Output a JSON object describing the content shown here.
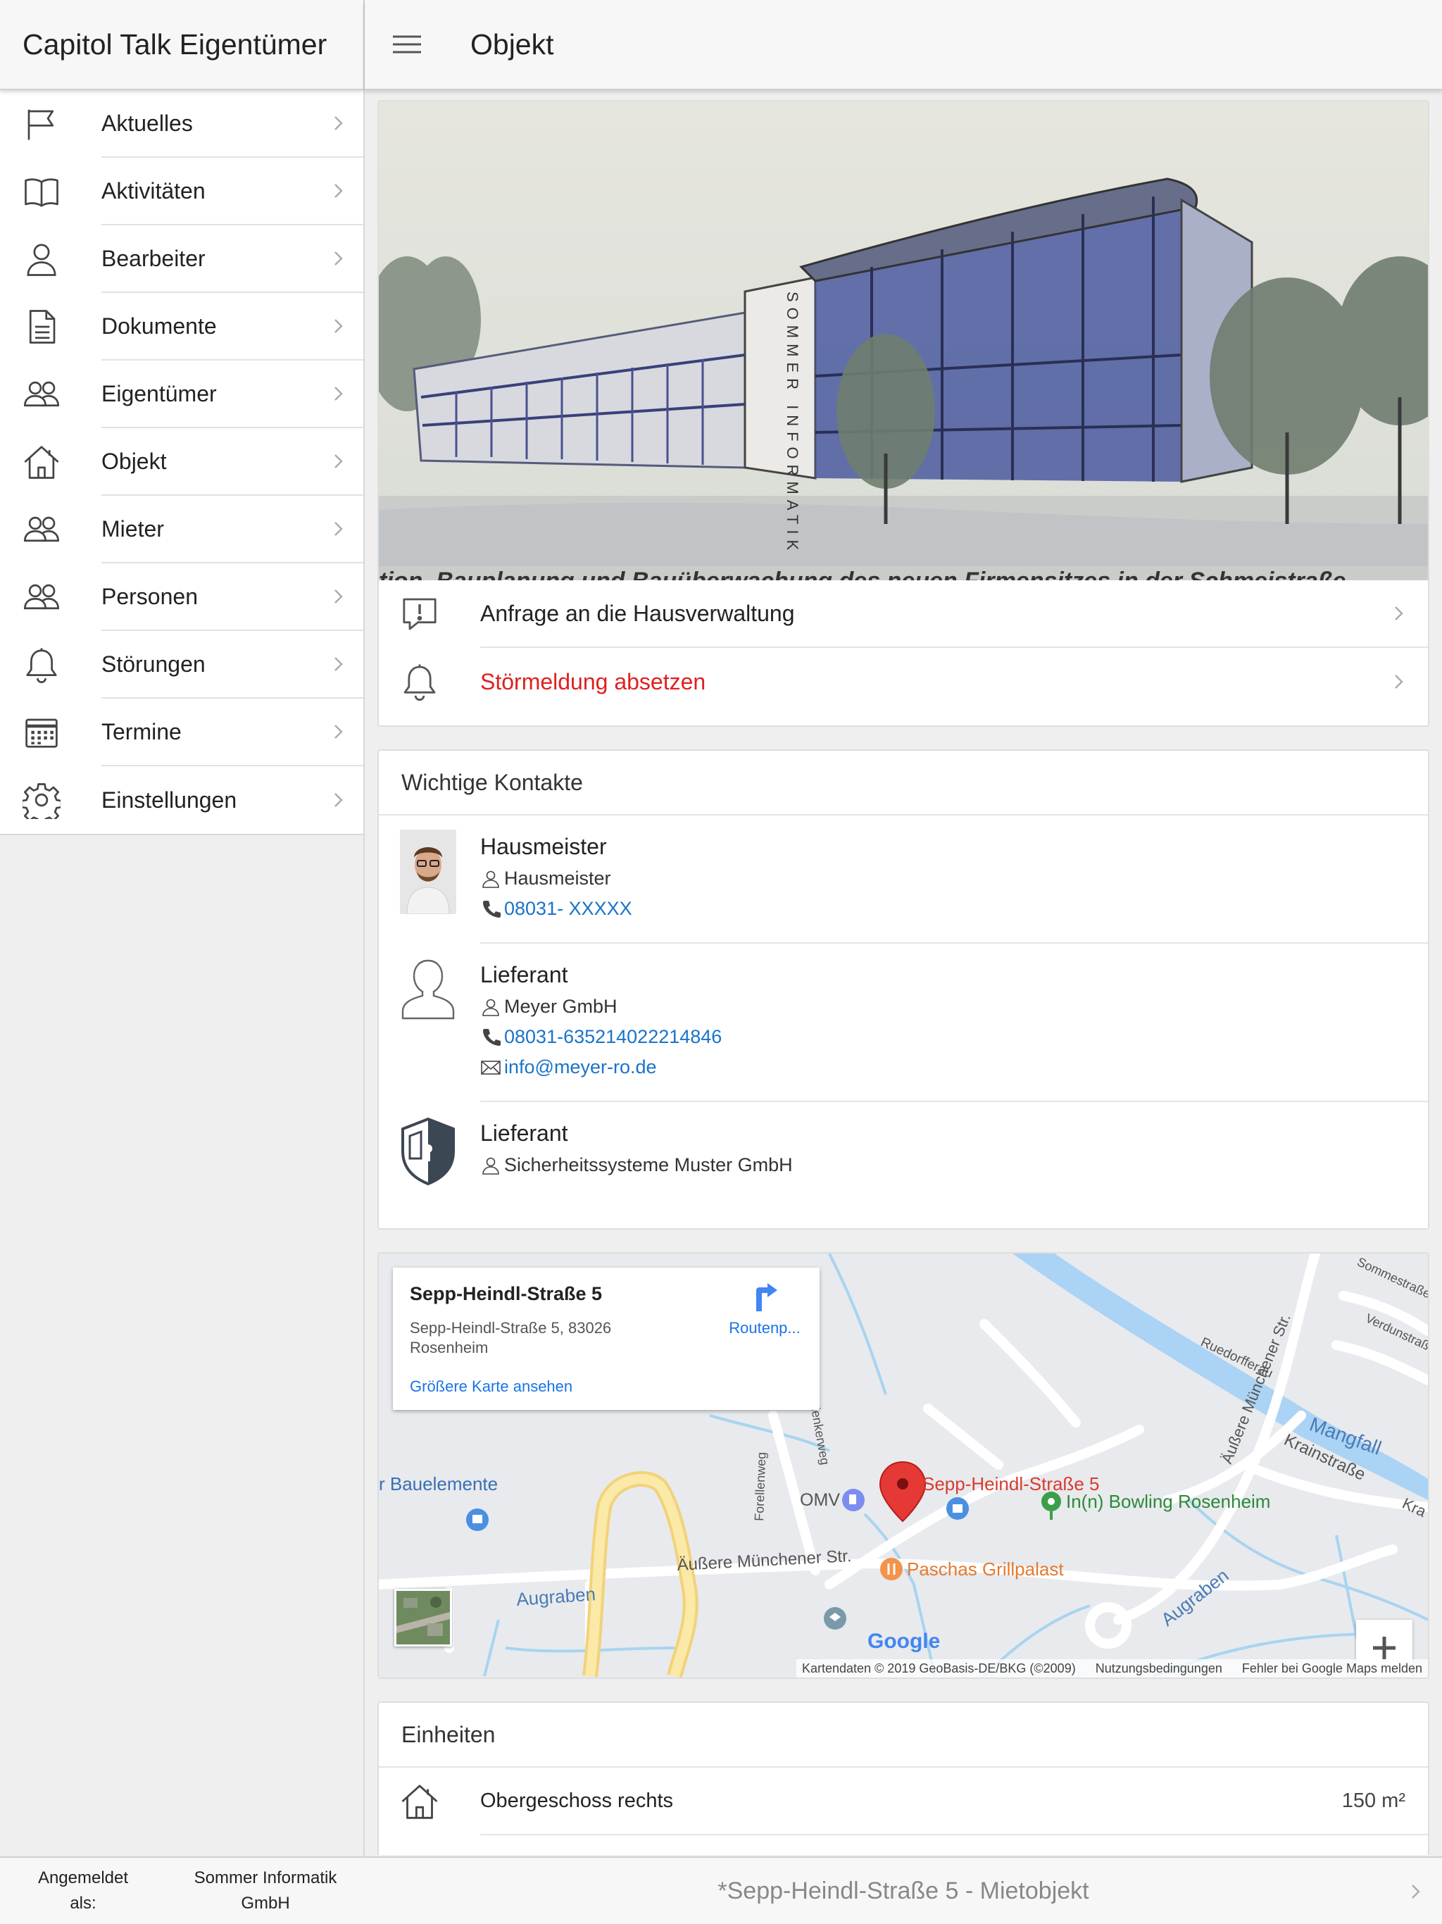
{
  "app": {
    "title": "Capitol Talk Eigentümer"
  },
  "topbar": {
    "title": "Objekt"
  },
  "menu": {
    "items": [
      {
        "label": "Aktuelles",
        "icon": "flag-icon"
      },
      {
        "label": "Aktivitäten",
        "icon": "book-icon"
      },
      {
        "label": "Bearbeiter",
        "icon": "person-icon"
      },
      {
        "label": "Dokumente",
        "icon": "document-icon"
      },
      {
        "label": "Eigentümer",
        "icon": "people-icon"
      },
      {
        "label": "Objekt",
        "icon": "home-icon"
      },
      {
        "label": "Mieter",
        "icon": "people-icon"
      },
      {
        "label": "Personen",
        "icon": "people-icon"
      },
      {
        "label": "Störungen",
        "icon": "bell-icon"
      },
      {
        "label": "Termine",
        "icon": "calendar-icon"
      },
      {
        "label": "Einstellungen",
        "icon": "gear-icon"
      }
    ]
  },
  "footer": {
    "login_label": "Angemeldet als:",
    "login_company": "Sommer Informatik GmbH",
    "object_selector": "*Sepp-Heindl-Straße 5 - Mietobjekt"
  },
  "object_card": {
    "caption": "tion, Bauplanung und Bauüberwachung des neuen Firmensitzes in der Schmeistraße",
    "building_sign": "SOMMER INFORMATIK",
    "actions": [
      {
        "label": "Anfrage an die Hausverwaltung",
        "icon": "message-alert-icon"
      },
      {
        "label": "Störmeldung absetzen",
        "icon": "bell-icon"
      }
    ]
  },
  "contacts": {
    "title": "Wichtige Kontakte",
    "items": [
      {
        "role": "Hausmeister",
        "name": "Hausmeister",
        "phone": "08031- XXXXX",
        "email": ""
      },
      {
        "role": "Lieferant",
        "name": "Meyer GmbH",
        "phone": "08031-635214022214846",
        "email": "info@meyer-ro.de"
      },
      {
        "role": "Lieferant",
        "name": "Sicherheitssysteme Muster GmbH",
        "phone": "",
        "email": ""
      }
    ]
  },
  "map": {
    "info_title": "Sepp-Heindl-Straße 5",
    "info_address": "Sepp-Heindl-Straße 5, 83026 Rosenheim",
    "info_link": "Größere Karte ansehen",
    "route_label": "Routenp...",
    "labels": {
      "pin": "Sepp-Heindl-Straße 5",
      "bowling": "In(n) Bowling Rosenheim",
      "grill": "Paschas Grillpalast",
      "omv": "OMV",
      "bauelemente": "r Bauelemente",
      "aeussere": "Äußere Münchener Str.",
      "augraben1": "Augraben",
      "augraben2": "Augraben",
      "mangfall": "Mangfall",
      "krainstr": "Krainstraße",
      "aeussere_v": "Äußere Münchener Str.",
      "ruedorfferau": "Ruedorfferau",
      "forellenweg": "Forellenweg",
      "lenkerweg": "lenkerweg",
      "sommestr": "Sommestraße",
      "verdunstr": "Verdunstraße",
      "kra": "Kra",
      "google": "Google"
    },
    "footer_data": "Kartendaten © 2019 GeoBasis-DE/BKG (©2009)",
    "footer_terms": "Nutzungsbedingungen",
    "footer_report": "Fehler bei Google Maps melden",
    "colors": {
      "water": "#a8d4f0",
      "road_yellow": "#f7e08a",
      "pin": "#e53935"
    }
  },
  "units": {
    "title": "Einheiten",
    "items": [
      {
        "label": "Obergeschoss rechts",
        "size": "150 m²"
      }
    ]
  }
}
